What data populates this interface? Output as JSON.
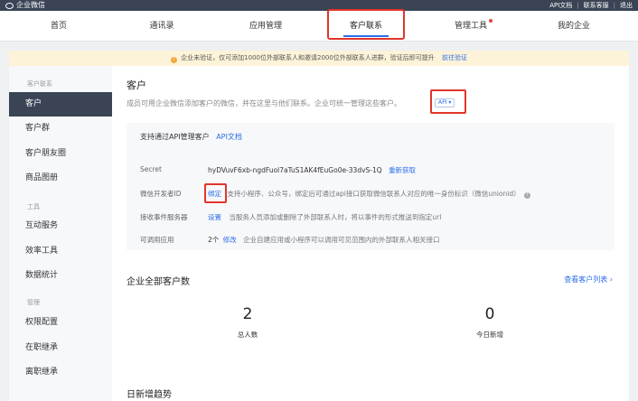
{
  "topbar": {
    "brand": "企业微信",
    "links": [
      "API文档",
      "联系客服",
      "退出"
    ]
  },
  "nav": {
    "items": [
      "首页",
      "通讯录",
      "应用管理",
      "客户联系",
      "管理工具",
      "我的企业"
    ],
    "active": "客户联系"
  },
  "notice": {
    "icon": "warning-icon",
    "text": "企业未验证，仅可添加1000位外部联系人和邀请2000位外部联系人进群，验证后即可提升",
    "link": "前往验证"
  },
  "sidebar": {
    "groups": [
      {
        "label": "客户联系",
        "items": [
          "客户",
          "客户群",
          "客户朋友圈",
          "商品图册"
        ]
      },
      {
        "label": "工具",
        "items": [
          "互动服务",
          "效率工具",
          "数据统计"
        ]
      },
      {
        "label": "管理",
        "items": [
          "权限配置",
          "在职继承",
          "离职继承"
        ]
      }
    ],
    "active": "客户"
  },
  "main": {
    "title": "客户",
    "description": "成员可用企业微信添加客户的微信，并在这里与他们联系。企业可统一管理这些客户。",
    "api_badge": "API",
    "panel": {
      "support_text": "支持通过API管理客户",
      "support_link": "API文档",
      "secret_label": "Secret",
      "secret_value": "hyDVuvF6xb-ngdFuol7aTuS1AK4fEuGo0e-33dvS-1Q",
      "secret_action": "重新获取",
      "wxdev_label": "微信开发者ID",
      "wxdev_action": "绑定",
      "wxdev_desc": "支持小程序、公众号，绑定后可通过api接口获取微信联系人对应的唯一身份标识（微信unionid）",
      "event_label": "接收事件服务器",
      "event_action": "设置",
      "event_desc": "当服务人员添加或删除了外部联系人时，将以事件的形式推送到指定url",
      "apps_label": "可调用应用",
      "apps_count": "2个",
      "apps_action": "修改",
      "apps_desc": "企业自建应用或小程序可以调用可见范围内的外部联系人相关接口"
    },
    "stats": {
      "title": "企业全部客户数",
      "view_link": "查看客户列表 ›",
      "total_value": "2",
      "total_label": "总人数",
      "today_value": "0",
      "today_label": "今日新增"
    },
    "trend_title": "日新增趋势"
  }
}
